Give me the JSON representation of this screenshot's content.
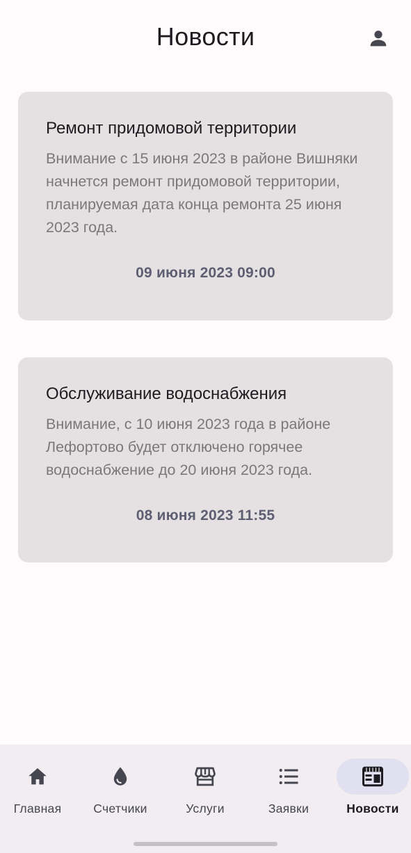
{
  "header": {
    "title": "Новости",
    "profile_icon": "person-icon"
  },
  "news": [
    {
      "title": "Ремонт придомовой территории",
      "body": "Внимание с 15 июня 2023 в районе Вишняки начнется ремонт придомовой территории, планируемая дата конца ремонта 25 июня 2023 года.",
      "date": "09 июня 2023 09:00"
    },
    {
      "title": "Обслуживание водоснабжения",
      "body": "Внимание, с 10 июня 2023 года в районе Лефортово будет отключено горячее водоснабжение до 20 июня 2023 года.",
      "date": "08 июня 2023 11:55"
    }
  ],
  "nav": {
    "items": [
      {
        "label": "Главная",
        "icon": "home-icon"
      },
      {
        "label": "Счетчики",
        "icon": "water-drop-icon"
      },
      {
        "label": "Услуги",
        "icon": "storefront-icon"
      },
      {
        "label": "Заявки",
        "icon": "list-icon"
      },
      {
        "label": "Новости",
        "icon": "newspaper-icon",
        "active": true
      }
    ]
  },
  "colors": {
    "background": "#fffbfc",
    "card": "#e5e1e2",
    "date_text": "#5d5e72",
    "nav_bg": "#f1edf1",
    "nav_active_pill": "#e0e0f0"
  }
}
